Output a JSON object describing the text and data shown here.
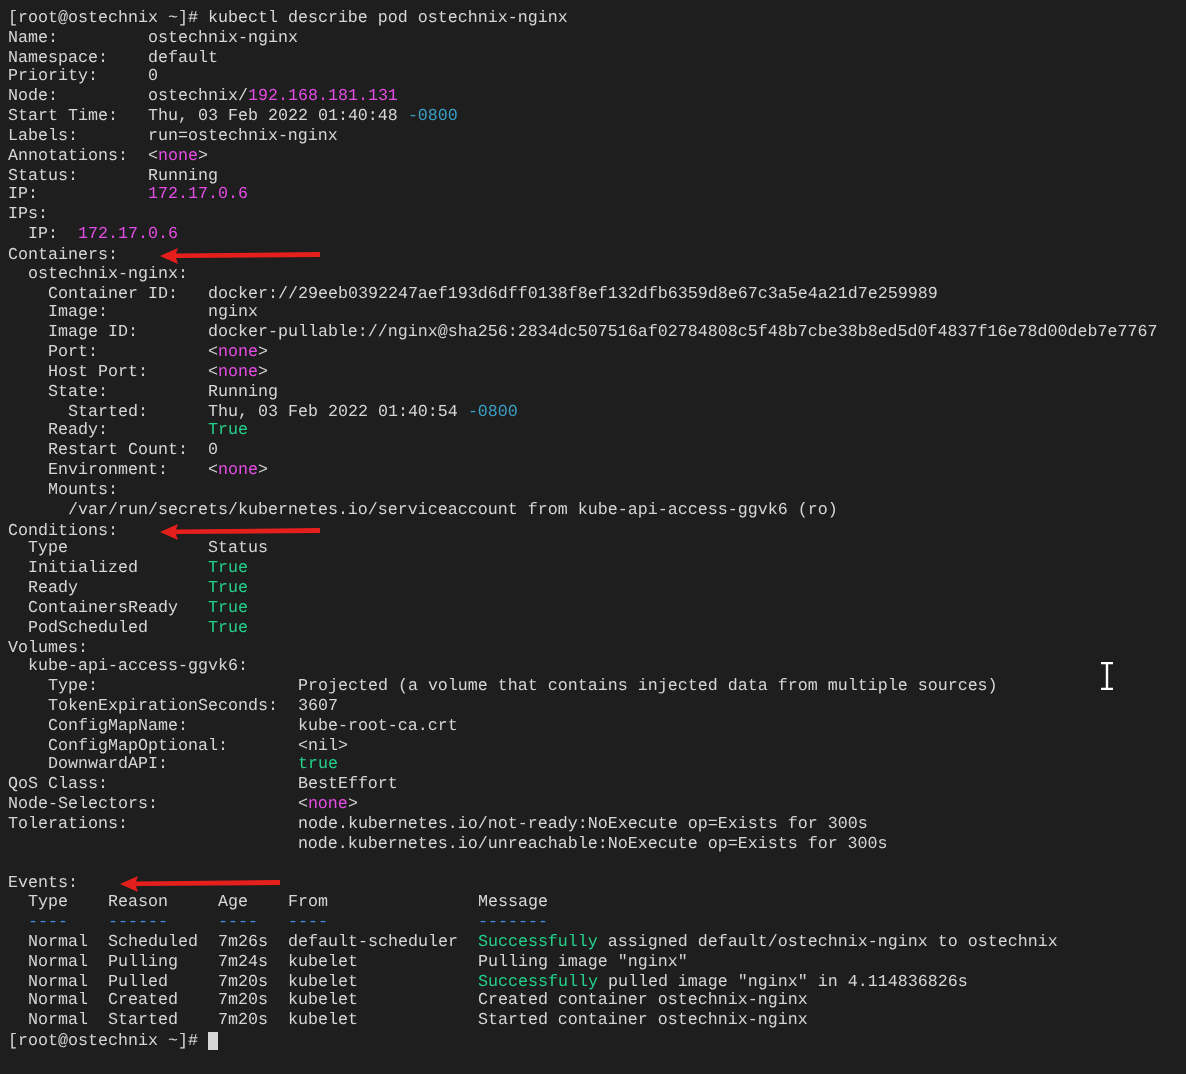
{
  "terminal": {
    "lines": [
      {
        "prompt": "[root@ostechnix ~]#",
        "command": " kubectl describe pod ostechnix-nginx"
      },
      {
        "label": "Name:",
        "value": "         ostechnix-nginx"
      },
      {
        "label": "Namespace:",
        "value": "    default"
      },
      {
        "label": "Priority:",
        "value": "     0"
      },
      {
        "label": "Node:",
        "value_runs": [
          {
            "text": "         ostechnix/"
          },
          {
            "text": "192.168.181.131",
            "color": "#e64ce6"
          }
        ]
      },
      {
        "label": "Start Time:",
        "value_runs": [
          {
            "text": "   Thu, 03 Feb 2022 01:40:48 "
          },
          {
            "text": "-0800",
            "color": "#3a9fc6"
          }
        ]
      },
      {
        "label": "Labels:",
        "value": "       run=ostechnix-nginx"
      },
      {
        "label": "Annotations:",
        "value_runs": [
          {
            "text": "  <"
          },
          {
            "text": "none",
            "color": "#e64ce6"
          },
          {
            "text": ">"
          }
        ]
      },
      {
        "label": "Status:",
        "value": "       Running"
      },
      {
        "label": "IP:",
        "value_runs": [
          {
            "text": "           172.17.0.6",
            "color": "#e64ce6"
          }
        ]
      },
      {
        "label": "IPs:"
      },
      {
        "label": "  IP:",
        "value_runs": [
          {
            "text": "  172.17.0.6",
            "color": "#e64ce6"
          }
        ]
      },
      {
        "label": "Containers:",
        "arrow": true
      },
      {
        "label": "  ostechnix-nginx:"
      },
      {
        "label": "    Container ID:",
        "value": "   docker://29eeb0392247aef193d6dff0138f8ef132dfb6359d8e67c3a5e4a21d7e259989"
      },
      {
        "label": "    Image:",
        "value": "          nginx"
      },
      {
        "label": "    Image ID:",
        "value": "       docker-pullable://nginx@sha256:2834dc507516af02784808c5f48b7cbe38b8ed5d0f4837f16e78d00deb7e7767"
      },
      {
        "label": "    Port:",
        "value_runs": [
          {
            "text": "           <"
          },
          {
            "text": "none",
            "color": "#e64ce6"
          },
          {
            "text": ">"
          }
        ]
      },
      {
        "label": "    Host Port:",
        "value_runs": [
          {
            "text": "      <"
          },
          {
            "text": "none",
            "color": "#e64ce6"
          },
          {
            "text": ">"
          }
        ]
      },
      {
        "label": "    State:",
        "value": "          Running"
      },
      {
        "label": "      Started:",
        "value_runs": [
          {
            "text": "      Thu, 03 Feb 2022 01:40:54 "
          },
          {
            "text": "-0800",
            "color": "#3a9fc6"
          }
        ]
      },
      {
        "label": "    Ready:",
        "value_runs": [
          {
            "text": "          True",
            "color": "#23d18b"
          }
        ]
      },
      {
        "label": "    Restart Count:",
        "value": "  0"
      },
      {
        "label": "    Environment:",
        "value_runs": [
          {
            "text": "    <"
          },
          {
            "text": "none",
            "color": "#e64ce6"
          },
          {
            "text": ">"
          }
        ]
      },
      {
        "label": "    Mounts:"
      },
      {
        "value": "      /var/run/secrets/kubernetes.io/serviceaccount from kube-api-access-ggvk6 (ro)"
      },
      {
        "label": "Conditions:",
        "arrow": true
      },
      {
        "headers": [
          "  Type",
          "              Status"
        ]
      },
      {
        "label": "  Initialized",
        "value_runs": [
          {
            "text": "       True",
            "color": "#23d18b"
          }
        ]
      },
      {
        "label": "  Ready",
        "value_runs": [
          {
            "text": "             True",
            "color": "#23d18b"
          }
        ]
      },
      {
        "label": "  ContainersReady",
        "value_runs": [
          {
            "text": "   True",
            "color": "#23d18b"
          }
        ]
      },
      {
        "label": "  PodScheduled",
        "value_runs": [
          {
            "text": "      True",
            "color": "#23d18b"
          }
        ]
      },
      {
        "label": "Volumes:"
      },
      {
        "label": "  kube-api-access-ggvk6:"
      },
      {
        "label": "    Type:",
        "value": "                    Projected (a volume that contains injected data from multiple sources)"
      },
      {
        "label": "    TokenExpirationSeconds:",
        "value": "  3607"
      },
      {
        "label": "    ConfigMapName:",
        "value": "           kube-root-ca.crt"
      },
      {
        "label": "    ConfigMapOptional:",
        "value": "       <nil>"
      },
      {
        "label": "    DownwardAPI:",
        "value_runs": [
          {
            "text": "             true",
            "color": "#23d18b"
          }
        ]
      },
      {
        "label": "QoS Class:",
        "value": "                   BestEffort"
      },
      {
        "label": "Node-Selectors:",
        "value_runs": [
          {
            "text": "              <"
          },
          {
            "text": "none",
            "color": "#e64ce6"
          },
          {
            "text": ">"
          }
        ]
      },
      {
        "label": "Tolerations:",
        "value": "                 node.kubernetes.io/not-ready:NoExecute op=Exists for 300s"
      },
      {
        "value": "                             node.kubernetes.io/unreachable:NoExecute op=Exists for 300s"
      },
      {
        "blank": true
      },
      {
        "label": "Events:",
        "arrow": true
      },
      {
        "headers": [
          "  Type",
          "    Reason",
          "     Age",
          "    From",
          "               Message"
        ]
      },
      {
        "dividers": [
          "  ----",
          "    ------",
          "     ----",
          "   ----",
          "               -------"
        ]
      },
      {
        "cells": [
          [
            {
              "text": "  Normal"
            }
          ],
          [
            {
              "text": "  Scheduled"
            }
          ],
          [
            {
              "text": "  7m26s"
            }
          ],
          [
            {
              "text": "  default-scheduler"
            }
          ],
          [
            {
              "text": "  Successfully",
              "color": "#23d18b"
            },
            {
              "text": " assigned default/ostechnix-nginx to ostechnix"
            }
          ]
        ]
      },
      {
        "cells": [
          [
            {
              "text": "  Normal"
            }
          ],
          [
            {
              "text": "  Pulling"
            }
          ],
          [
            {
              "text": "    7m24s"
            }
          ],
          [
            {
              "text": "  kubelet"
            }
          ],
          [
            {
              "text": "            Pulling image \"nginx\""
            }
          ]
        ]
      },
      {
        "cells": [
          [
            {
              "text": "  Normal"
            }
          ],
          [
            {
              "text": "  Pulled"
            }
          ],
          [
            {
              "text": "     7m20s"
            }
          ],
          [
            {
              "text": "  kubelet"
            }
          ],
          [
            {
              "text": "            Successfully",
              "color": "#23d18b"
            },
            {
              "text": " pulled image \"nginx\" in 4.114836826s"
            }
          ]
        ]
      },
      {
        "cells": [
          [
            {
              "text": "  Normal"
            }
          ],
          [
            {
              "text": "  Created"
            }
          ],
          [
            {
              "text": "    7m20s"
            }
          ],
          [
            {
              "text": "  kubelet"
            }
          ],
          [
            {
              "text": "            Created container ostechnix-nginx"
            }
          ]
        ]
      },
      {
        "cells": [
          [
            {
              "text": "  Normal"
            }
          ],
          [
            {
              "text": "  Started"
            }
          ],
          [
            {
              "text": "    7m20s"
            }
          ],
          [
            {
              "text": "  kubelet"
            }
          ],
          [
            {
              "text": "            Started container ostechnix-nginx"
            }
          ]
        ]
      },
      {
        "prompt": "[root@ostechnix ~]#",
        "cursor": true
      }
    ]
  }
}
